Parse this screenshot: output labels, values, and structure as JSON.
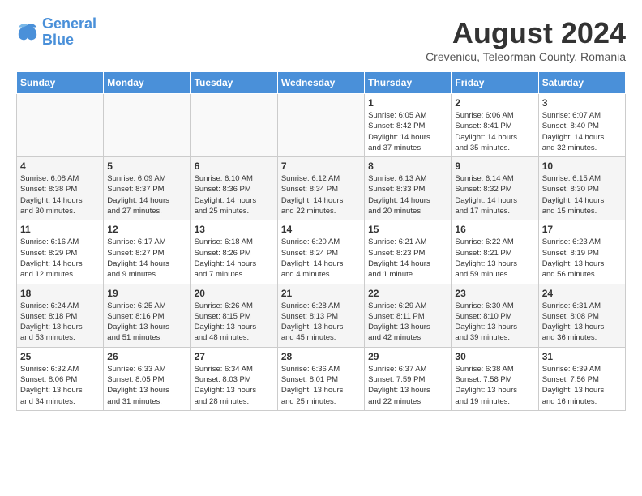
{
  "logo": {
    "line1": "General",
    "line2": "Blue"
  },
  "title": "August 2024",
  "location": "Crevenicu, Teleorman County, Romania",
  "days_of_week": [
    "Sunday",
    "Monday",
    "Tuesday",
    "Wednesday",
    "Thursday",
    "Friday",
    "Saturday"
  ],
  "weeks": [
    [
      {
        "day": "",
        "info": ""
      },
      {
        "day": "",
        "info": ""
      },
      {
        "day": "",
        "info": ""
      },
      {
        "day": "",
        "info": ""
      },
      {
        "day": "1",
        "info": "Sunrise: 6:05 AM\nSunset: 8:42 PM\nDaylight: 14 hours\nand 37 minutes."
      },
      {
        "day": "2",
        "info": "Sunrise: 6:06 AM\nSunset: 8:41 PM\nDaylight: 14 hours\nand 35 minutes."
      },
      {
        "day": "3",
        "info": "Sunrise: 6:07 AM\nSunset: 8:40 PM\nDaylight: 14 hours\nand 32 minutes."
      }
    ],
    [
      {
        "day": "4",
        "info": "Sunrise: 6:08 AM\nSunset: 8:38 PM\nDaylight: 14 hours\nand 30 minutes."
      },
      {
        "day": "5",
        "info": "Sunrise: 6:09 AM\nSunset: 8:37 PM\nDaylight: 14 hours\nand 27 minutes."
      },
      {
        "day": "6",
        "info": "Sunrise: 6:10 AM\nSunset: 8:36 PM\nDaylight: 14 hours\nand 25 minutes."
      },
      {
        "day": "7",
        "info": "Sunrise: 6:12 AM\nSunset: 8:34 PM\nDaylight: 14 hours\nand 22 minutes."
      },
      {
        "day": "8",
        "info": "Sunrise: 6:13 AM\nSunset: 8:33 PM\nDaylight: 14 hours\nand 20 minutes."
      },
      {
        "day": "9",
        "info": "Sunrise: 6:14 AM\nSunset: 8:32 PM\nDaylight: 14 hours\nand 17 minutes."
      },
      {
        "day": "10",
        "info": "Sunrise: 6:15 AM\nSunset: 8:30 PM\nDaylight: 14 hours\nand 15 minutes."
      }
    ],
    [
      {
        "day": "11",
        "info": "Sunrise: 6:16 AM\nSunset: 8:29 PM\nDaylight: 14 hours\nand 12 minutes."
      },
      {
        "day": "12",
        "info": "Sunrise: 6:17 AM\nSunset: 8:27 PM\nDaylight: 14 hours\nand 9 minutes."
      },
      {
        "day": "13",
        "info": "Sunrise: 6:18 AM\nSunset: 8:26 PM\nDaylight: 14 hours\nand 7 minutes."
      },
      {
        "day": "14",
        "info": "Sunrise: 6:20 AM\nSunset: 8:24 PM\nDaylight: 14 hours\nand 4 minutes."
      },
      {
        "day": "15",
        "info": "Sunrise: 6:21 AM\nSunset: 8:23 PM\nDaylight: 14 hours\nand 1 minute."
      },
      {
        "day": "16",
        "info": "Sunrise: 6:22 AM\nSunset: 8:21 PM\nDaylight: 13 hours\nand 59 minutes."
      },
      {
        "day": "17",
        "info": "Sunrise: 6:23 AM\nSunset: 8:19 PM\nDaylight: 13 hours\nand 56 minutes."
      }
    ],
    [
      {
        "day": "18",
        "info": "Sunrise: 6:24 AM\nSunset: 8:18 PM\nDaylight: 13 hours\nand 53 minutes."
      },
      {
        "day": "19",
        "info": "Sunrise: 6:25 AM\nSunset: 8:16 PM\nDaylight: 13 hours\nand 51 minutes."
      },
      {
        "day": "20",
        "info": "Sunrise: 6:26 AM\nSunset: 8:15 PM\nDaylight: 13 hours\nand 48 minutes."
      },
      {
        "day": "21",
        "info": "Sunrise: 6:28 AM\nSunset: 8:13 PM\nDaylight: 13 hours\nand 45 minutes."
      },
      {
        "day": "22",
        "info": "Sunrise: 6:29 AM\nSunset: 8:11 PM\nDaylight: 13 hours\nand 42 minutes."
      },
      {
        "day": "23",
        "info": "Sunrise: 6:30 AM\nSunset: 8:10 PM\nDaylight: 13 hours\nand 39 minutes."
      },
      {
        "day": "24",
        "info": "Sunrise: 6:31 AM\nSunset: 8:08 PM\nDaylight: 13 hours\nand 36 minutes."
      }
    ],
    [
      {
        "day": "25",
        "info": "Sunrise: 6:32 AM\nSunset: 8:06 PM\nDaylight: 13 hours\nand 34 minutes."
      },
      {
        "day": "26",
        "info": "Sunrise: 6:33 AM\nSunset: 8:05 PM\nDaylight: 13 hours\nand 31 minutes."
      },
      {
        "day": "27",
        "info": "Sunrise: 6:34 AM\nSunset: 8:03 PM\nDaylight: 13 hours\nand 28 minutes."
      },
      {
        "day": "28",
        "info": "Sunrise: 6:36 AM\nSunset: 8:01 PM\nDaylight: 13 hours\nand 25 minutes."
      },
      {
        "day": "29",
        "info": "Sunrise: 6:37 AM\nSunset: 7:59 PM\nDaylight: 13 hours\nand 22 minutes."
      },
      {
        "day": "30",
        "info": "Sunrise: 6:38 AM\nSunset: 7:58 PM\nDaylight: 13 hours\nand 19 minutes."
      },
      {
        "day": "31",
        "info": "Sunrise: 6:39 AM\nSunset: 7:56 PM\nDaylight: 13 hours\nand 16 minutes."
      }
    ]
  ]
}
